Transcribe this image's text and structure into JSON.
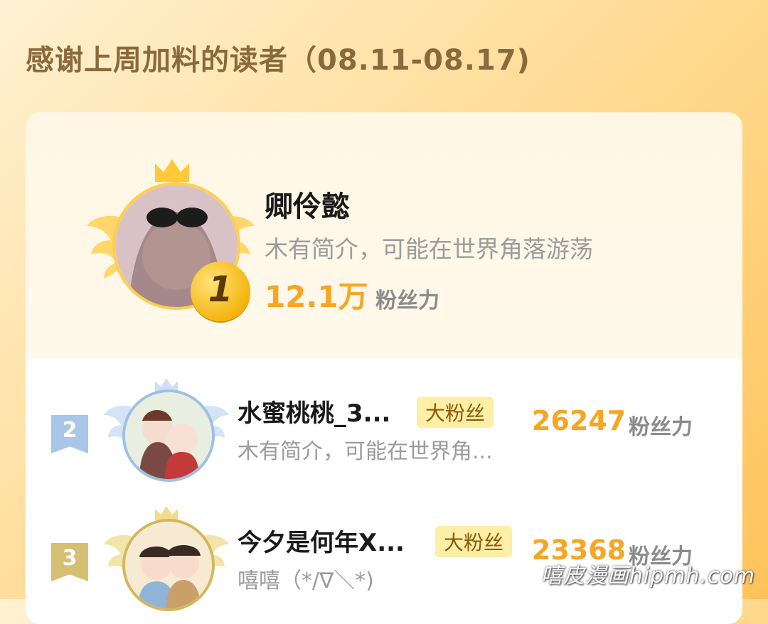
{
  "header": {
    "title": "感谢上周加料的读者（08.11-08.17)"
  },
  "first": {
    "rank": "1",
    "name": "卿伶懿",
    "bio": "木有简介，可能在世界角落游荡",
    "score": "12.1万",
    "unit": "粉丝力"
  },
  "rows": [
    {
      "rank": "2",
      "name": "水蜜桃桃_3...",
      "tag": "大粉丝",
      "bio": "木有简介，可能在世界角...",
      "score": "26247",
      "unit": "粉丝力"
    },
    {
      "rank": "3",
      "name": "今夕是何年X...",
      "tag": "大粉丝",
      "bio": "嘻嘻（*/∇＼*)",
      "score": "23368",
      "unit": "粉丝力"
    }
  ],
  "watermark": "嘻皮漫画hipmh.com",
  "colors": {
    "accent": "#f6a623",
    "gold": "#ffcf4a",
    "silver": "#a9c6e8",
    "bronze": "#d6bf72"
  }
}
